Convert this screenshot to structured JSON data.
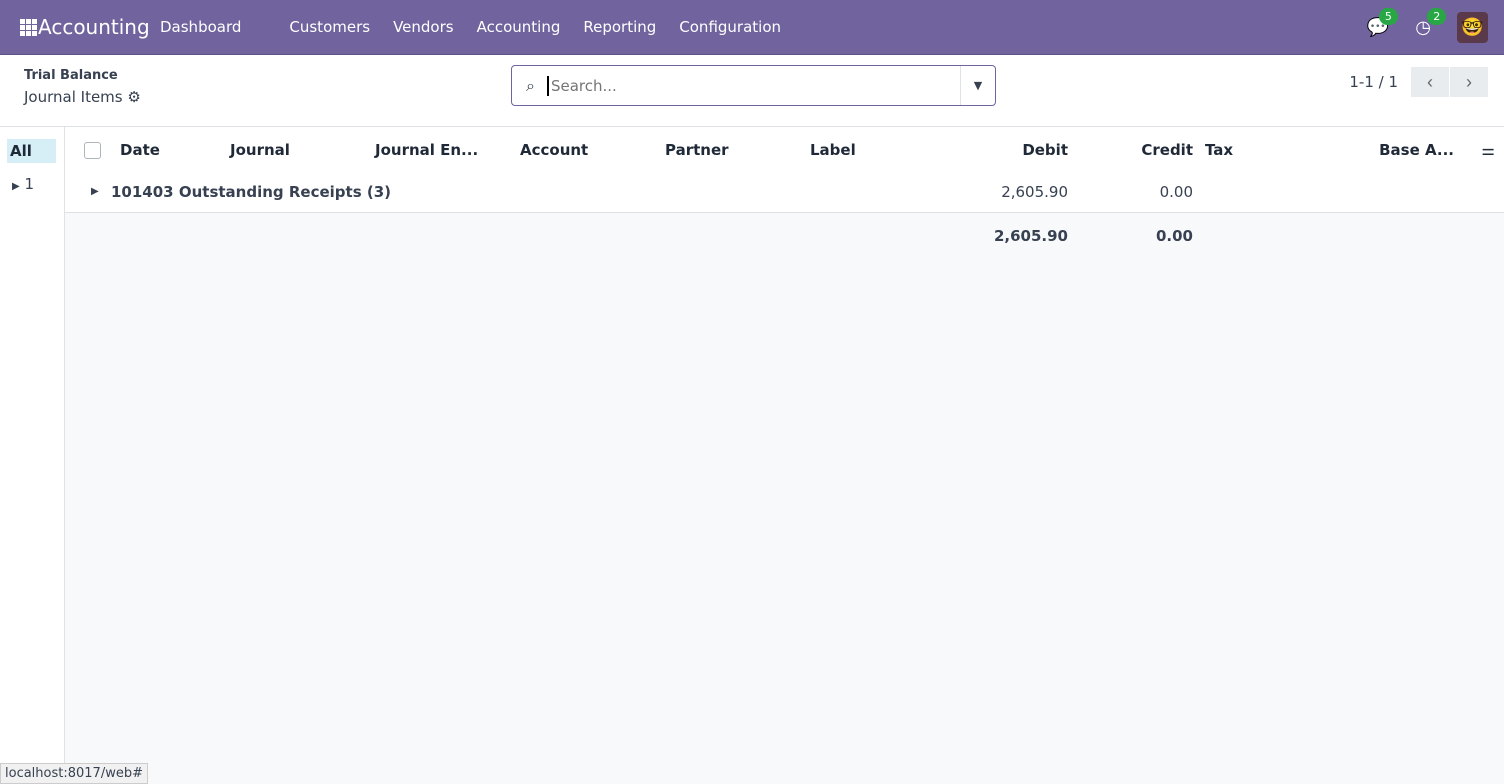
{
  "nav": {
    "app": "Accounting",
    "menu": [
      "Dashboard",
      "Customers",
      "Vendors",
      "Accounting",
      "Reporting",
      "Configuration"
    ],
    "messages_count": "5",
    "activities_count": "2"
  },
  "breadcrumb": {
    "parent": "Trial Balance",
    "current": "Journal Items"
  },
  "search": {
    "placeholder": "Search..."
  },
  "pager": {
    "text": "1-1 / 1"
  },
  "sidebar": {
    "all": "All",
    "item": "1"
  },
  "table": {
    "columns": [
      "Date",
      "Journal",
      "Journal En...",
      "Account",
      "Partner",
      "Label",
      "Debit",
      "Credit",
      "Tax",
      "Base A..."
    ],
    "group": {
      "label": "101403 Outstanding Receipts (3)",
      "debit": "2,605.90",
      "credit": "0.00"
    },
    "totals": {
      "debit": "2,605.90",
      "credit": "0.00"
    }
  },
  "status_url": "localhost:8017/web#"
}
